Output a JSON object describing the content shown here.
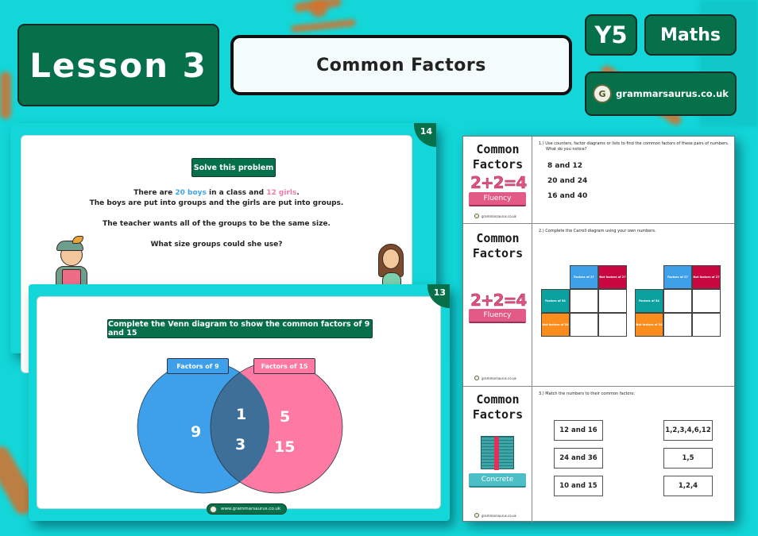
{
  "header": {
    "lesson": "Lesson 3",
    "topic": "Common Factors",
    "year": "Y5",
    "subject": "Maths",
    "brand": "grammarsaurus.co.uk",
    "brand_logo_letter": "G"
  },
  "slide_14": {
    "number": "14",
    "label": "Solve this problem",
    "line1_prefix": "There are ",
    "line1_boys": "20 boys",
    "line1_mid": " in a class and ",
    "line1_girls": "12 girls",
    "line1_suffix": ".",
    "line2": "The boys are put into groups and the girls are put into groups.",
    "line3": "The teacher wants all of the groups to be the same size.",
    "line4": "What size groups could she use?"
  },
  "slide_13": {
    "number": "13",
    "label": "Complete the Venn diagram to show the common factors of 9 and 15",
    "left_set": {
      "title": "Factors of 9",
      "only": [
        "9"
      ],
      "color": "#3ea0ea"
    },
    "right_set": {
      "title": "Factors of 15",
      "only": [
        "5",
        "15"
      ],
      "color": "#ff7aa2"
    },
    "intersection": [
      "1",
      "3"
    ],
    "intersection_color": "#3e6f98",
    "footer": "www.grammarsaurus.co.uk"
  },
  "worksheet": {
    "rows": [
      {
        "title_line1": "Common",
        "title_line2": "Factors",
        "graphic": "2+2=4",
        "stage": "Fluency",
        "brand": "grammarsaurus.co.uk",
        "question": "1.) Use counters, factor diagrams or lists to find the common factors of these pairs of numbers.",
        "question_sub": "What do you notice?",
        "pairs": [
          "8 and 12",
          "20 and 24",
          "16 and 40"
        ]
      },
      {
        "title_line1": "Common",
        "title_line2": "Factors",
        "graphic": "2+2=4",
        "stage": "Fluency",
        "brand": "grammarsaurus.co.uk",
        "question": "2.) Complete the Carroll diagram using your own numbers.",
        "carroll": {
          "col_headers": [
            "Factors of 27",
            "Not factors of 27"
          ],
          "row_headers": [
            "Factors of 54",
            "Not factors of 54"
          ]
        }
      },
      {
        "title_line1": "Common",
        "title_line2": "Factors",
        "stage": "Concrete",
        "brand": "grammarsaurus.co.uk",
        "question": "3.) Match the numbers to their common factors:",
        "left_items": [
          "12 and 16",
          "24 and 36",
          "10 and 15"
        ],
        "right_items": [
          "1,2,3,4,6,12",
          "1,5",
          "1,2,4"
        ]
      }
    ]
  }
}
